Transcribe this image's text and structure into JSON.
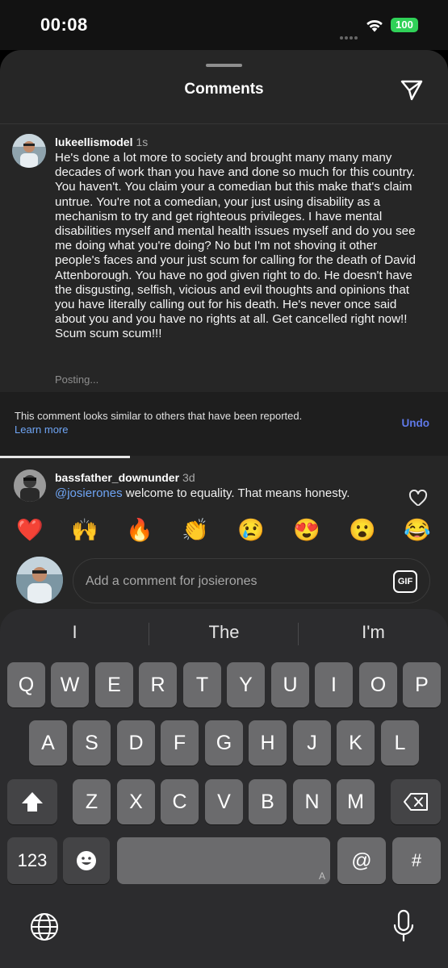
{
  "status_bar": {
    "time": "00:08",
    "battery": "100"
  },
  "sheet": {
    "title": "Comments"
  },
  "comment1": {
    "username": "lukeellismodel",
    "time": "1s",
    "text": "He's done a lot more to society and brought many many many decades of work than you have and done so much for this country. You haven't. You claim your a comedian but this make that's claim untrue. You're not a comedian, your just using disability as a mechanism to try and get righteous privileges. I have mental disabilities myself and mental health issues myself and do you see me doing what you're doing? No but I'm not shoving it other people's faces and your just scum for calling for the death of David Attenborough. You have no god given right to do. He doesn't have the disgusting, selfish, vicious and evil thoughts and opinions that you have literally calling out for his death. He's never once said about you and you have no rights at all. Get cancelled right now!! Scum scum scum!!!",
    "status": "Posting..."
  },
  "report": {
    "message": "This comment looks similar to others that have been reported.",
    "learn_more": "Learn more",
    "undo": "Undo",
    "progress": 0.29
  },
  "comment2": {
    "username": "bassfather_downunder",
    "time": "3d",
    "mention": "@josierones",
    "text": " welcome to equality.  That means honesty."
  },
  "emojis": [
    "❤️",
    "🙌",
    "🔥",
    "👏",
    "😢",
    "😍",
    "😮",
    "😂"
  ],
  "comment_input": {
    "placeholder": "Add a comment for josierones",
    "gif_label": "GIF"
  },
  "keyboard": {
    "suggestions": [
      "I",
      "The",
      "I'm"
    ],
    "row1": [
      "Q",
      "W",
      "E",
      "R",
      "T",
      "Y",
      "U",
      "I",
      "O",
      "P"
    ],
    "row2": [
      "A",
      "S",
      "D",
      "F",
      "G",
      "H",
      "J",
      "K",
      "L"
    ],
    "row3": [
      "Z",
      "X",
      "C",
      "V",
      "B",
      "N",
      "M"
    ],
    "numbers_label": "123",
    "at_label": "@",
    "hash_label": "#",
    "space_hint": "A"
  }
}
